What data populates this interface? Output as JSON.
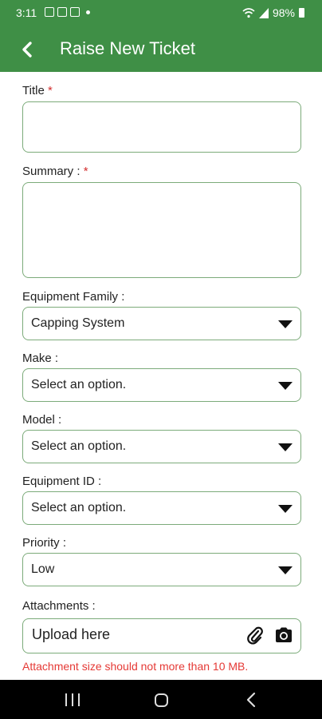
{
  "status_bar": {
    "time": "3:11",
    "battery": "98%"
  },
  "header": {
    "title": "Raise New Ticket"
  },
  "form": {
    "title_label": "Title",
    "summary_label": "Summary :",
    "required_mark": "*",
    "equipment_family": {
      "label": "Equipment Family :",
      "value": "Capping System"
    },
    "make": {
      "label": "Make :",
      "value": "Select an option."
    },
    "model": {
      "label": "Model :",
      "value": "Select an option."
    },
    "equipment_id": {
      "label": "Equipment ID :",
      "value": "Select an option."
    },
    "priority": {
      "label": "Priority :",
      "value": "Low"
    },
    "attachments": {
      "label": "Attachments :",
      "placeholder": "Upload here"
    },
    "size_warning": "Attachment size should not more than 10 MB."
  },
  "icons": {
    "back": "arrow-left-icon",
    "dropdown": "caret-down-icon",
    "attach": "paperclip-icon",
    "camera": "camera-icon"
  },
  "colors": {
    "primary": "#3f8f46",
    "border": "#7cab7a",
    "error": "#e53935"
  }
}
